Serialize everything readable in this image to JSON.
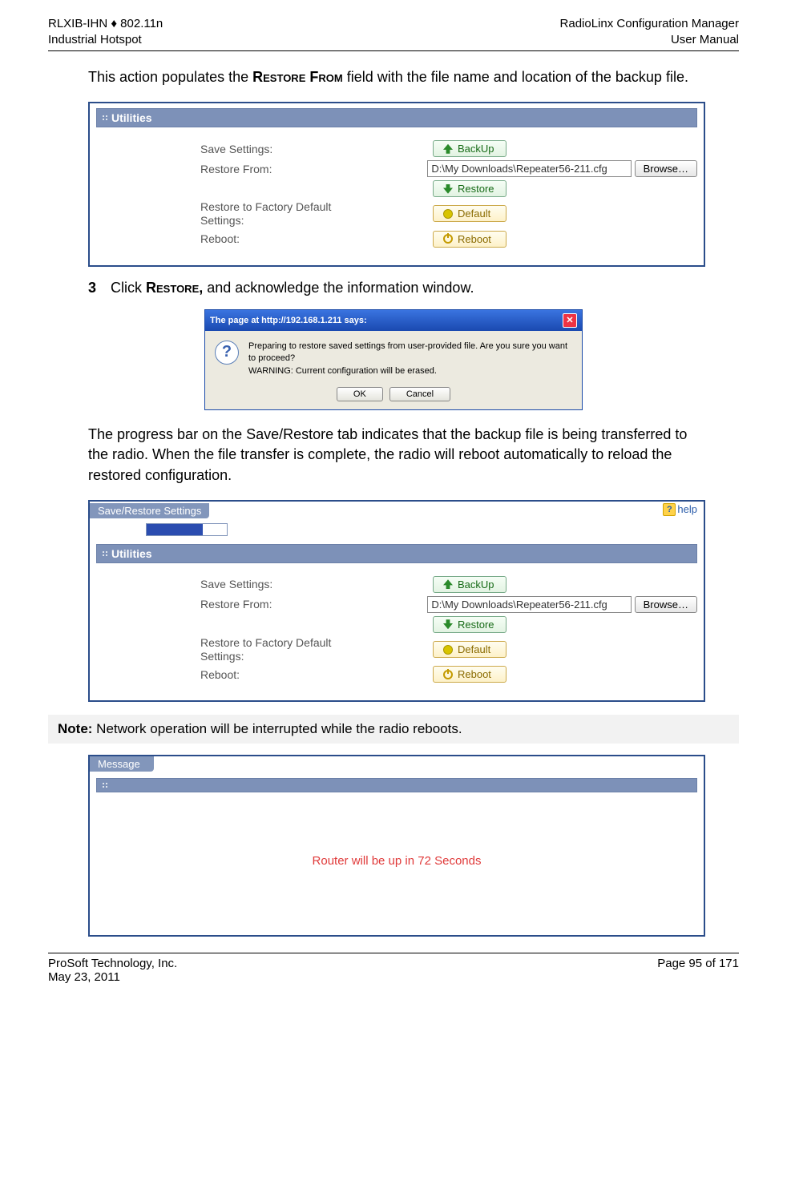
{
  "header": {
    "left1": "RLXIB-IHN ♦ 802.11n",
    "left2": "Industrial Hotspot",
    "right1": "RadioLinx Configuration Manager",
    "right2": "User Manual"
  },
  "intro": {
    "pre": "This action populates the ",
    "sc": "Restore From",
    "post": " field with the file name and location of the backup file."
  },
  "utilities": {
    "title": "Utilities",
    "rows": {
      "save_label": "Save Settings:",
      "restore_label": "Restore From:",
      "factory_label1": "Restore to Factory Default",
      "factory_label2": "Settings:",
      "reboot_label": "Reboot:"
    },
    "buttons": {
      "backup": "BackUp",
      "restore": "Restore",
      "default": "Default",
      "reboot": "Reboot",
      "browse": "Browse…"
    },
    "restore_value": "D:\\My Downloads\\Repeater56-211.cfg"
  },
  "step3": {
    "num": "3",
    "pre": "Click ",
    "sc": "Restore,",
    "post": " and acknowledge the information window."
  },
  "dialog": {
    "title": "The page at http://192.168.1.211 says:",
    "line1": "Preparing to restore saved settings from user-provided file. Are you sure you want to proceed?",
    "line2": "WARNING: Current configuration will be erased.",
    "ok": "OK",
    "cancel": "Cancel"
  },
  "para2": "The progress bar on the Save/Restore tab indicates that the backup file is being transferred to the radio. When the file transfer is complete, the radio will reboot automatically to reload the restored configuration.",
  "sr": {
    "tab": "Save/Restore Settings",
    "help": "help"
  },
  "note": {
    "label": "Note:",
    "text": " Network operation will be interrupted while the radio reboots."
  },
  "msg": {
    "tab": "Message",
    "text": "Router will be up in 72 Seconds"
  },
  "footer": {
    "left1": "ProSoft Technology, Inc.",
    "left2": "May 23, 2011",
    "right": "Page 95 of 171"
  }
}
